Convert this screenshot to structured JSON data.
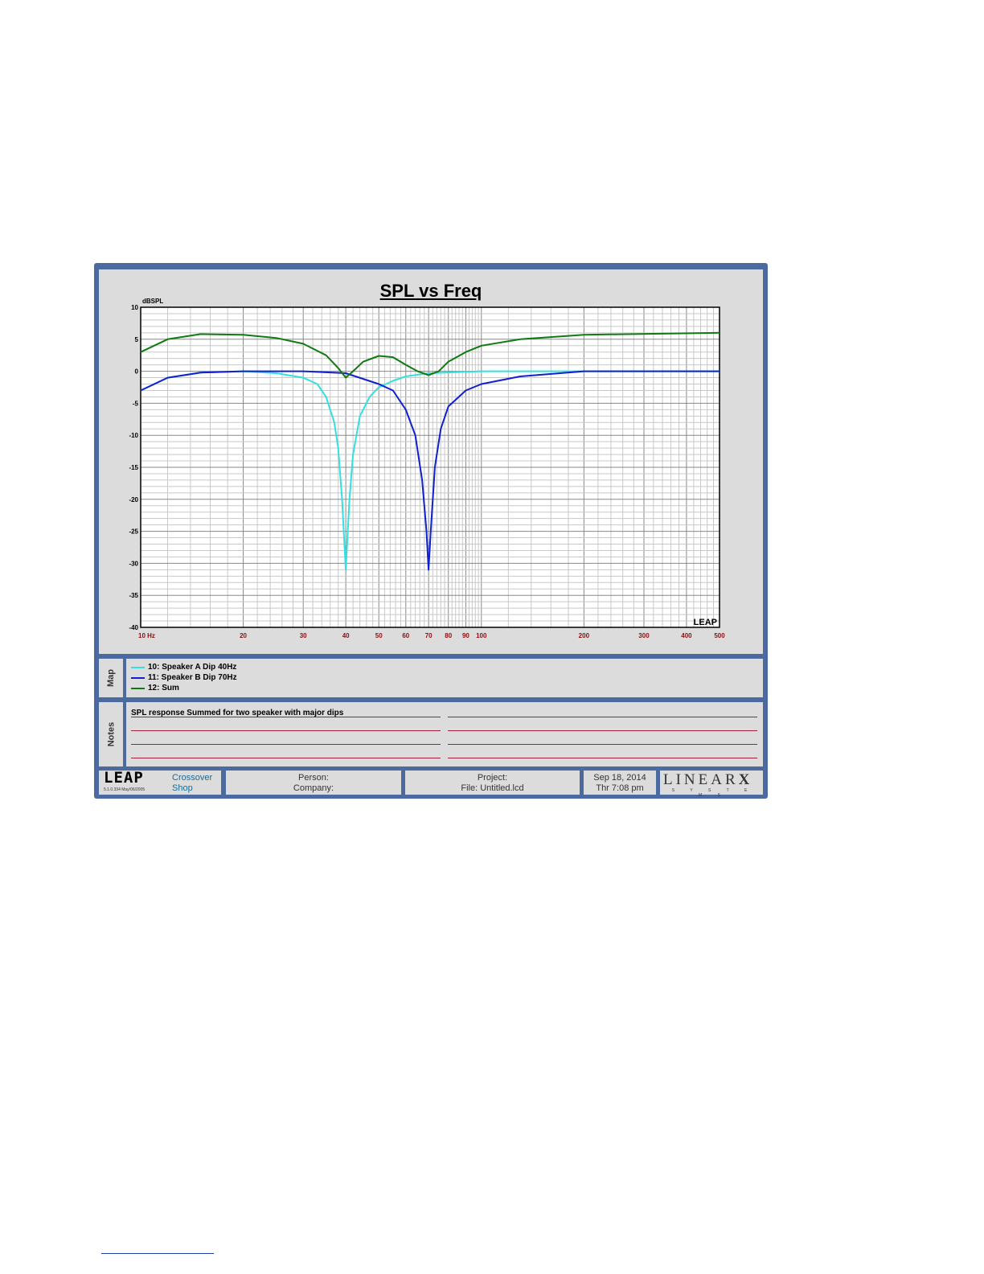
{
  "chart_data": {
    "type": "line",
    "title": "SPL vs Freq",
    "ylabel": "dBSPL",
    "xlabel": "",
    "xscale": "log",
    "xlim": [
      10,
      500
    ],
    "ylim": [
      -40,
      10
    ],
    "grid": true,
    "x_tick_labels": [
      {
        "v": 10,
        "t": "10  Hz"
      },
      {
        "v": 20,
        "t": "20"
      },
      {
        "v": 30,
        "t": "30"
      },
      {
        "v": 40,
        "t": "40"
      },
      {
        "v": 50,
        "t": "50"
      },
      {
        "v": 60,
        "t": "60"
      },
      {
        "v": 70,
        "t": "70"
      },
      {
        "v": 80,
        "t": "80"
      },
      {
        "v": 90,
        "t": "90"
      },
      {
        "v": 100,
        "t": "100"
      },
      {
        "v": 200,
        "t": "200"
      },
      {
        "v": 300,
        "t": "300"
      },
      {
        "v": 400,
        "t": "400"
      },
      {
        "v": 500,
        "t": "500"
      }
    ],
    "y_ticks": [
      10,
      5,
      0,
      -5,
      -10,
      -15,
      -20,
      -25,
      -30,
      -35,
      -40
    ],
    "series": [
      {
        "name": "10: Speaker A Dip 40Hz",
        "color": "#33e0e0",
        "x": [
          10,
          12,
          15,
          20,
          25,
          30,
          33,
          35,
          37,
          38,
          39,
          40,
          41,
          42,
          44,
          47,
          50,
          55,
          60,
          70,
          100,
          500
        ],
        "y": [
          -3,
          -1,
          -0.2,
          0,
          -0.3,
          -1,
          -2,
          -4,
          -8,
          -12,
          -20,
          -31,
          -20,
          -13,
          -7,
          -4,
          -2.5,
          -1.5,
          -0.8,
          -0.3,
          0,
          0
        ]
      },
      {
        "name": "11: Speaker B Dip 70Hz",
        "color": "#1020d0",
        "x": [
          10,
          12,
          15,
          20,
          30,
          40,
          50,
          55,
          60,
          64,
          67,
          69,
          70,
          71,
          73,
          76,
          80,
          90,
          100,
          130,
          200,
          500
        ],
        "y": [
          -3,
          -1,
          -0.2,
          0,
          0,
          -0.3,
          -2,
          -3,
          -6,
          -10,
          -17,
          -25,
          -31,
          -25,
          -15,
          -9,
          -5.5,
          -3,
          -2,
          -0.8,
          0,
          0
        ]
      },
      {
        "name": "12: Sum",
        "color": "#107a10",
        "x": [
          10,
          12,
          15,
          20,
          25,
          30,
          35,
          38,
          40,
          42,
          45,
          50,
          55,
          60,
          65,
          70,
          75,
          80,
          90,
          100,
          130,
          200,
          500
        ],
        "y": [
          3,
          5,
          5.8,
          5.7,
          5.2,
          4.3,
          2.5,
          0.5,
          -1,
          0,
          1.5,
          2.4,
          2.2,
          1,
          0,
          -0.6,
          0,
          1.5,
          3,
          4,
          5,
          5.7,
          6
        ]
      }
    ],
    "legend": "map panel below chart",
    "watermark": "LEAP"
  },
  "map": {
    "label": "Map"
  },
  "notes": {
    "label": "Notes",
    "text": "SPL response Summed for two speaker with major dips"
  },
  "footer": {
    "logo": "LEAP",
    "version": "5.1.0.334  May/06/2005",
    "product_line1": "Crossover",
    "product_line2": "Shop",
    "person": "Person:",
    "company": "Company:",
    "project": "Project:",
    "file": "File: Untitled.lcd",
    "date": "Sep 18, 2014",
    "time": "Thr  7:08 pm",
    "brand": "LINEAR",
    "brand_x": "X",
    "brand_sub": "S Y S T E M S"
  }
}
